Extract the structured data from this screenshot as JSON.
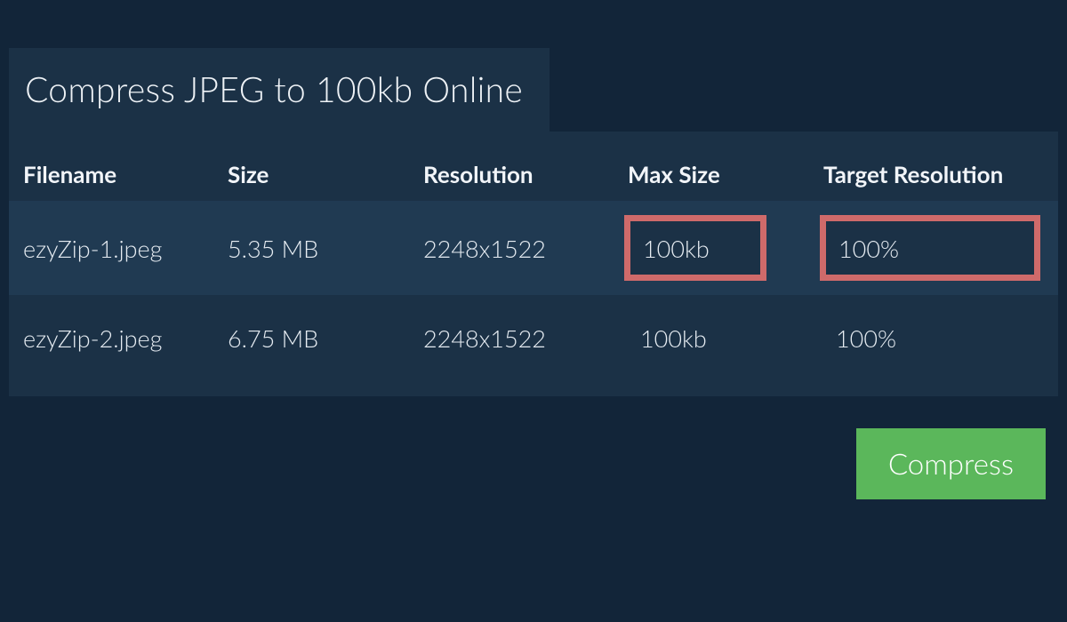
{
  "header": {
    "title": "Compress JPEG to 100kb Online"
  },
  "table": {
    "columns": {
      "filename": "Filename",
      "size": "Size",
      "resolution": "Resolution",
      "max_size": "Max Size",
      "target_resolution": "Target Resolution"
    },
    "rows": [
      {
        "filename": "ezyZip-1.jpeg",
        "size": "5.35 MB",
        "resolution": "2248x1522",
        "max_size": "100kb",
        "target_resolution": "100%",
        "highlighted": true
      },
      {
        "filename": "ezyZip-2.jpeg",
        "size": "6.75 MB",
        "resolution": "2248x1522",
        "max_size": "100kb",
        "target_resolution": "100%",
        "highlighted": false
      }
    ]
  },
  "actions": {
    "compress_label": "Compress"
  }
}
